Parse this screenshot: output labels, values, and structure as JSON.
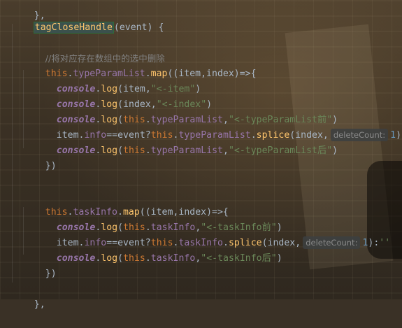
{
  "editor": {
    "line0": {
      "text": "},",
      "indent": 2
    },
    "line1": {
      "fn": "tagCloseHandle",
      "rest": "(event) {"
    },
    "line2": {
      "comment": "//将对应存在数组中的选中删除"
    },
    "line3": {
      "this": "this",
      "dot1": ".",
      "prop": "typeParamList",
      "dot2": ".",
      "map": "map",
      "rest": "((item,index)=>{"
    },
    "line4": {
      "console": "console",
      "dot": ".",
      "log": "log",
      "args": "(item,",
      "str": "\"<-item\"",
      "close": ")"
    },
    "line5": {
      "console": "console",
      "dot": ".",
      "log": "log",
      "args": "(index,",
      "str": "\"<-index\"",
      "close": ")"
    },
    "line6": {
      "console": "console",
      "dot": ".",
      "log": "log",
      "open": "(",
      "this": "this",
      "dot2": ".",
      "prop": "typeParamList",
      "comma": ",",
      "str": "\"<-typeParamList前\"",
      "close": ")"
    },
    "line7": {
      "a": "item.",
      "info": "info",
      "eq": "==event?",
      "this": "this",
      "dot": ".",
      "prop": "typeParamList",
      "dot2": ".",
      "splice": "splice",
      "args": "(index,",
      "hint": "deleteCount:",
      "num": "1",
      "tail": "):",
      "str": "''"
    },
    "line8": {
      "console": "console",
      "dot": ".",
      "log": "log",
      "open": "(",
      "this": "this",
      "dot2": ".",
      "prop": "typeParamList",
      "comma": ",",
      "str": "\"<-typeParamList后\"",
      "close": ")"
    },
    "line9": {
      "text": "})"
    },
    "line12": {
      "this": "this",
      "dot1": ".",
      "prop": "taskInfo",
      "dot2": ".",
      "map": "map",
      "rest": "((item,index)=>{"
    },
    "line13": {
      "console": "console",
      "dot": ".",
      "log": "log",
      "open": "(",
      "this": "this",
      "dot2": ".",
      "prop": "taskInfo",
      "comma": ",",
      "str": "\"<-taskInfo前\"",
      "close": ")"
    },
    "line14": {
      "a": "item.",
      "info": "info",
      "eq": "==event?",
      "this": "this",
      "dot": ".",
      "prop": "taskInfo",
      "dot2": ".",
      "splice": "splice",
      "args": "(index,",
      "hint": "deleteCount:",
      "num": "1",
      "tail": "):",
      "str": "''"
    },
    "line15": {
      "console": "console",
      "dot": ".",
      "log": "log",
      "open": "(",
      "this": "this",
      "dot2": ".",
      "prop": "taskInfo",
      "comma": ",",
      "str": "\"<-taskInfo后\"",
      "close": ")"
    },
    "line16": {
      "text": "})"
    },
    "line18": {
      "text": "},"
    }
  }
}
